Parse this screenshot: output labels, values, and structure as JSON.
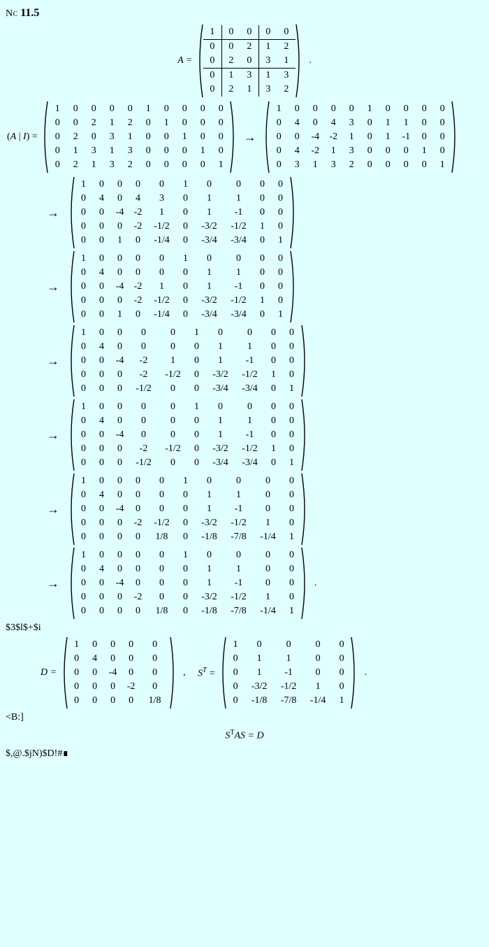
{
  "header": {
    "label": "Nc",
    "number": "11.5"
  },
  "matrix_A_label": "A",
  "matrix_A": [
    [
      "1",
      "0",
      "0",
      "0",
      "0"
    ],
    [
      "0",
      "0",
      "2",
      "1",
      "2"
    ],
    [
      "0",
      "2",
      "0",
      "3",
      "1"
    ],
    [
      "0",
      "1",
      "3",
      "1",
      "3"
    ],
    [
      "0",
      "2",
      "1",
      "3",
      "2"
    ]
  ],
  "AI_label_left": "(A | I) =",
  "AI_matrix": [
    [
      "1",
      "0",
      "0",
      "0",
      "0",
      "1",
      "0",
      "0",
      "0",
      "0"
    ],
    [
      "0",
      "0",
      "2",
      "1",
      "2",
      "0",
      "1",
      "0",
      "0",
      "0"
    ],
    [
      "0",
      "2",
      "0",
      "3",
      "1",
      "0",
      "0",
      "1",
      "0",
      "0"
    ],
    [
      "0",
      "1",
      "3",
      "1",
      "3",
      "0",
      "0",
      "0",
      "1",
      "0"
    ],
    [
      "0",
      "2",
      "1",
      "3",
      "2",
      "0",
      "0",
      "0",
      "0",
      "1"
    ]
  ],
  "step1": [
    [
      "1",
      "0",
      "0",
      "0",
      "0",
      "1",
      "0",
      "0",
      "0",
      "0"
    ],
    [
      "0",
      "4",
      "0",
      "4",
      "3",
      "0",
      "1",
      "1",
      "0",
      "0"
    ],
    [
      "0",
      "0",
      "-4",
      "-2",
      "1",
      "0",
      "1",
      "-1",
      "0",
      "0"
    ],
    [
      "0",
      "4",
      "-2",
      "1",
      "3",
      "0",
      "0",
      "0",
      "1",
      "0"
    ],
    [
      "0",
      "3",
      "1",
      "3",
      "2",
      "0",
      "0",
      "0",
      "0",
      "1"
    ]
  ],
  "step2": [
    [
      "1",
      "0",
      "0",
      "0",
      "0",
      "1",
      "0",
      "0",
      "0",
      "0"
    ],
    [
      "0",
      "4",
      "0",
      "4",
      "3",
      "0",
      "1",
      "1",
      "0",
      "0"
    ],
    [
      "0",
      "0",
      "-4",
      "-2",
      "1",
      "0",
      "1",
      "-1",
      "0",
      "0"
    ],
    [
      "0",
      "0",
      "0",
      "-2",
      "-1/2",
      "0",
      "-3/2",
      "-1/2",
      "1",
      "0"
    ],
    [
      "0",
      "0",
      "1",
      "0",
      "-1/4",
      "0",
      "-3/4",
      "-3/4",
      "0",
      "1"
    ]
  ],
  "step3": [
    [
      "1",
      "0",
      "0",
      "0",
      "0",
      "1",
      "0",
      "0",
      "0",
      "0"
    ],
    [
      "0",
      "4",
      "0",
      "0",
      "0",
      "0",
      "1",
      "1",
      "0",
      "0"
    ],
    [
      "0",
      "0",
      "-4",
      "-2",
      "1",
      "0",
      "1",
      "-1",
      "0",
      "0"
    ],
    [
      "0",
      "0",
      "0",
      "-2",
      "-1/2",
      "0",
      "-3/2",
      "-1/2",
      "1",
      "0"
    ],
    [
      "0",
      "0",
      "1",
      "0",
      "-1/4",
      "0",
      "-3/4",
      "-3/4",
      "0",
      "1"
    ]
  ],
  "step4": [
    [
      "1",
      "0",
      "0",
      "0",
      "0",
      "1",
      "0",
      "0",
      "0",
      "0"
    ],
    [
      "0",
      "4",
      "0",
      "0",
      "0",
      "0",
      "1",
      "1",
      "0",
      "0"
    ],
    [
      "0",
      "0",
      "-4",
      "-2",
      "1",
      "0",
      "1",
      "-1",
      "0",
      "0"
    ],
    [
      "0",
      "0",
      "0",
      "-2",
      "-1/2",
      "0",
      "-3/2",
      "-1/2",
      "1",
      "0"
    ],
    [
      "0",
      "0",
      "0",
      "-1/2",
      "0",
      "0",
      "-3/4",
      "-3/4",
      "0",
      "1"
    ]
  ],
  "step5": [
    [
      "1",
      "0",
      "0",
      "0",
      "0",
      "1",
      "0",
      "0",
      "0",
      "0"
    ],
    [
      "0",
      "4",
      "0",
      "0",
      "0",
      "0",
      "1",
      "1",
      "0",
      "0"
    ],
    [
      "0",
      "0",
      "-4",
      "0",
      "0",
      "0",
      "1",
      "-1",
      "0",
      "0"
    ],
    [
      "0",
      "0",
      "0",
      "-2",
      "-1/2",
      "0",
      "-3/2",
      "-1/2",
      "1",
      "0"
    ],
    [
      "0",
      "0",
      "0",
      "-1/2",
      "0",
      "0",
      "-3/4",
      "-3/4",
      "0",
      "1"
    ]
  ],
  "step6": [
    [
      "1",
      "0",
      "0",
      "0",
      "0",
      "1",
      "0",
      "0",
      "0",
      "0"
    ],
    [
      "0",
      "4",
      "0",
      "0",
      "0",
      "0",
      "1",
      "1",
      "0",
      "0"
    ],
    [
      "0",
      "0",
      "-4",
      "0",
      "0",
      "0",
      "1",
      "-1",
      "0",
      "0"
    ],
    [
      "0",
      "0",
      "0",
      "-2",
      "-1/2",
      "0",
      "-3/2",
      "-1/2",
      "1",
      "0"
    ],
    [
      "0",
      "0",
      "0",
      "0",
      "1/8",
      "0",
      "-1/8",
      "-7/8",
      "-1/4",
      "1"
    ]
  ],
  "step7": [
    [
      "1",
      "0",
      "0",
      "0",
      "0",
      "1",
      "0",
      "0",
      "0",
      "0"
    ],
    [
      "0",
      "4",
      "0",
      "0",
      "0",
      "0",
      "1",
      "1",
      "0",
      "0"
    ],
    [
      "0",
      "0",
      "-4",
      "0",
      "0",
      "0",
      "1",
      "-1",
      "0",
      "0"
    ],
    [
      "0",
      "0",
      "0",
      "-2",
      "0",
      "0",
      "-3/2",
      "-1/2",
      "1",
      "0"
    ],
    [
      "0",
      "0",
      "0",
      "0",
      "1/8",
      "0",
      "-1/8",
      "-7/8",
      "-1/4",
      "1"
    ]
  ],
  "text_mid": "$3$l$+$i",
  "D_label": "D",
  "D_matrix": [
    [
      "1",
      "0",
      "0",
      "0",
      "0"
    ],
    [
      "0",
      "4",
      "0",
      "0",
      "0"
    ],
    [
      "0",
      "0",
      "-4",
      "0",
      "0"
    ],
    [
      "0",
      "0",
      "0",
      "-2",
      "0"
    ],
    [
      "0",
      "0",
      "0",
      "0",
      "1/8"
    ]
  ],
  "ST_label": "S",
  "ST_sup": "T",
  "ST_matrix": [
    [
      "1",
      "0",
      "0",
      "0",
      "0"
    ],
    [
      "0",
      "1",
      "1",
      "0",
      "0"
    ],
    [
      "0",
      "1",
      "-1",
      "0",
      "0"
    ],
    [
      "0",
      "-3/2",
      "-1/2",
      "1",
      "0"
    ],
    [
      "0",
      "-1/8",
      "-7/8",
      "-1/4",
      "1"
    ]
  ],
  "text_B": "<B:]",
  "final_eq": "S",
  "final_eq_sup": "T",
  "final_eq_rest": "AS = D",
  "text_end": "$,@.$jN)$D!#",
  "square": "∎"
}
